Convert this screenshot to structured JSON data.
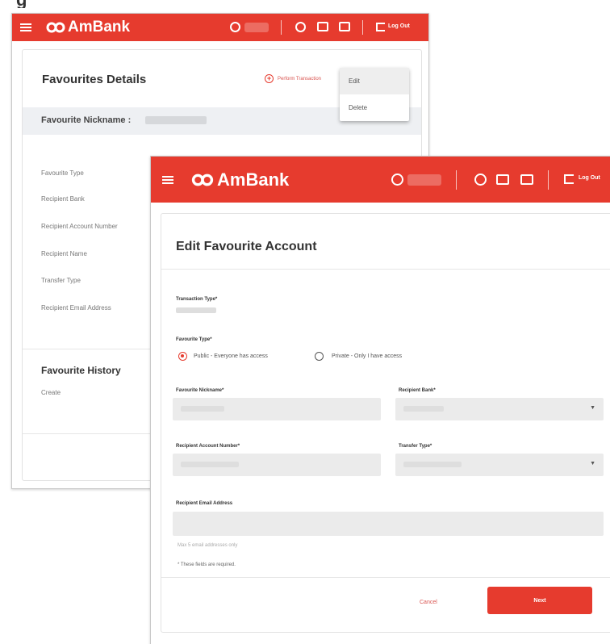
{
  "top_crop_text": "g",
  "brand": {
    "name": "AmBank",
    "color": "#e63b2e"
  },
  "header": {
    "logout_label": "Log Out",
    "icons": [
      "menu-icon",
      "user-icon",
      "help-icon",
      "inbox-icon",
      "chat-icon",
      "logout-icon"
    ]
  },
  "favourites": {
    "title": "Favourites Details",
    "perform_transaction": "Perform Transaction",
    "menu": {
      "edit": "Edit",
      "delete": "Delete"
    },
    "nickname_label": "Favourite Nickname :",
    "fields": [
      "Favourite Type",
      "Recipient Bank",
      "Recipient Account Number",
      "Recipient Name",
      "Transfer Type",
      "Recipient Email Address"
    ],
    "history_title": "Favourite History",
    "history_item": "Create"
  },
  "edit": {
    "title": "Edit Favourite Account",
    "transaction_type_label": "Transaction Type*",
    "favourite_type_label": "Favourite Type*",
    "radio_public": "Public - Everyone has access",
    "radio_private": "Private - Only I have access",
    "selected_type": "public",
    "nickname_label": "Favourite Nickname*",
    "recipient_bank_label": "Recipient Bank*",
    "account_number_label": "Recipient Account Number*",
    "transfer_type_label": "Transfer Type*",
    "email_label": "Recipient Email Address",
    "email_hint": "Max 5 email addresses only",
    "required_note": "* These fields are required.",
    "cancel_label": "Cancel",
    "next_label": "Next"
  }
}
